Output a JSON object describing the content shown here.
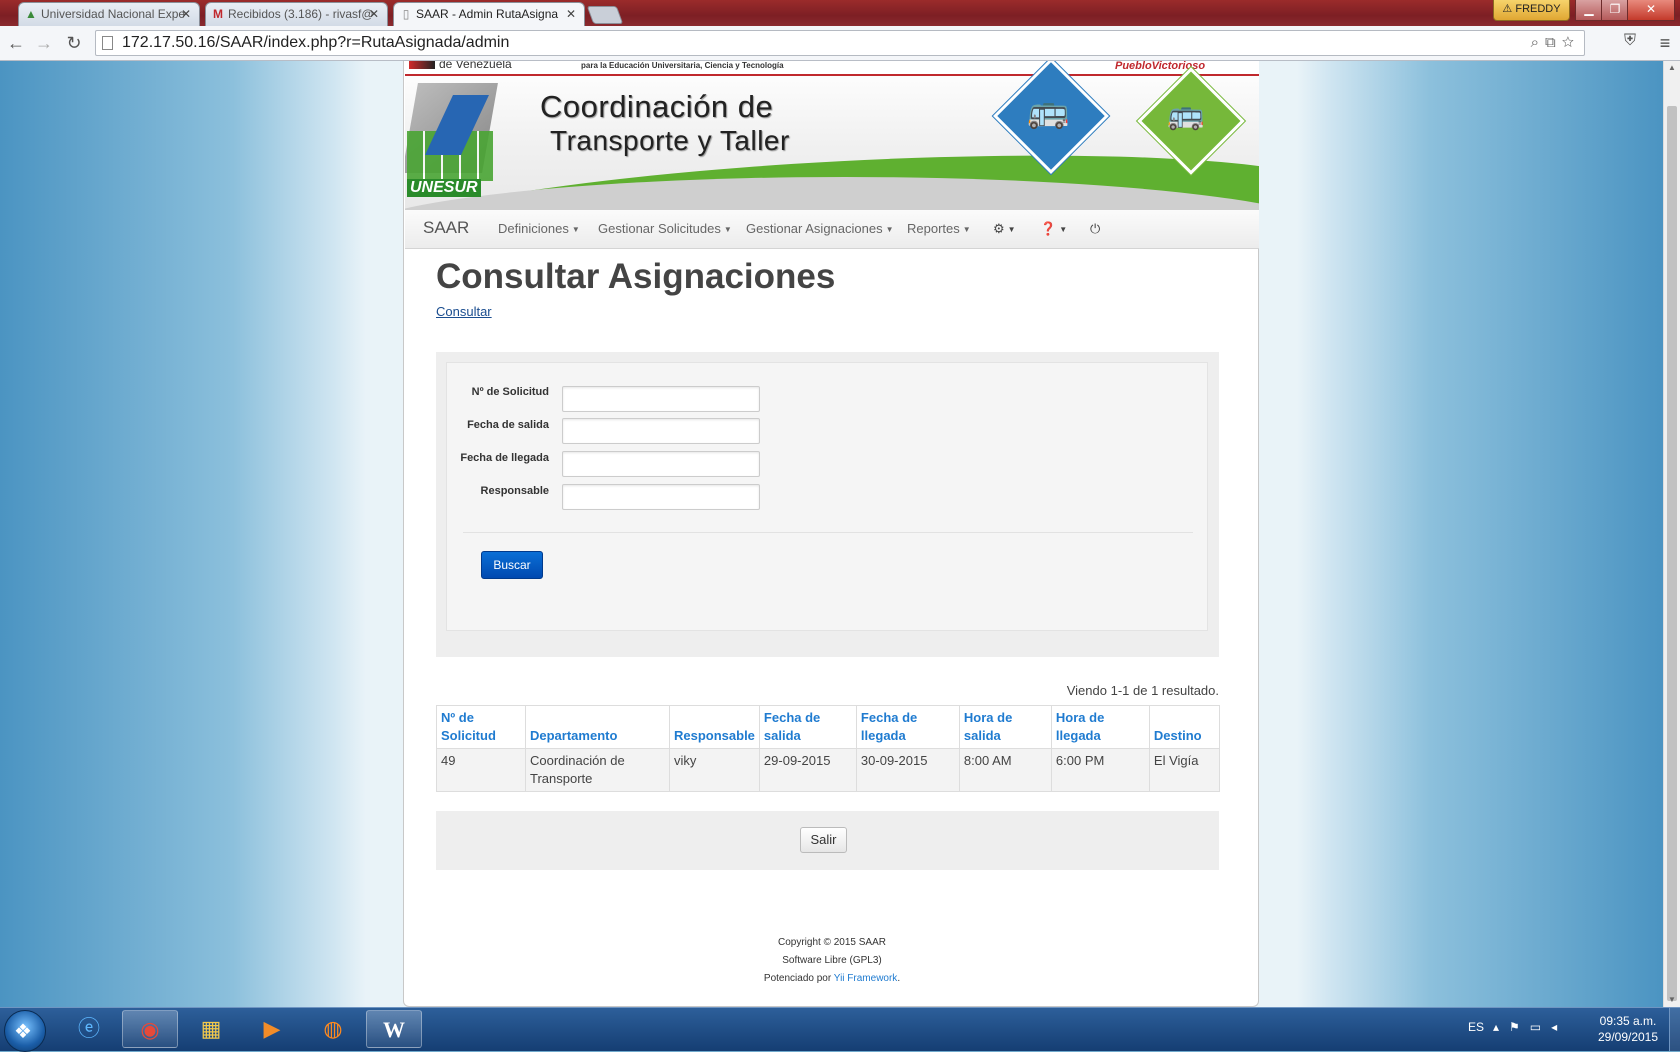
{
  "browser": {
    "tabs": [
      {
        "title": "Universidad Nacional Expe",
        "icon": "unesur-favicon"
      },
      {
        "title": "Recibidos (3.186) - rivasf@",
        "icon": "gmail-icon"
      },
      {
        "title": "SAAR - Admin RutaAsigna",
        "icon": "page-icon"
      }
    ],
    "user": "FREDDY",
    "address": "172.17.50.16/SAAR/index.php?r=RutaAsignada/admin"
  },
  "banner": {
    "gov_left": "de Venezuela",
    "gov_ministry": "para la Educación Universitaria, Ciencia y Tecnología",
    "gov_right": "PuebloVictorioso",
    "title_line1": "Coordinación de",
    "title_line2": "Transporte y Taller",
    "logo_text": "UNESUR"
  },
  "navbar": {
    "brand": "SAAR",
    "items": [
      "Definiciones",
      "Gestionar Solicitudes",
      "Gestionar Asignaciones",
      "Reportes"
    ]
  },
  "page": {
    "heading": "Consultar Asignaciones",
    "consult_link": "Consultar"
  },
  "search_form": {
    "fields": [
      {
        "label": "Nº de Solicitud",
        "value": ""
      },
      {
        "label": "Fecha de salida",
        "value": ""
      },
      {
        "label": "Fecha de llegada",
        "value": ""
      },
      {
        "label": "Responsable",
        "value": ""
      }
    ],
    "submit_label": "Buscar"
  },
  "results": {
    "summary": "Viendo 1-1 de 1 resultado.",
    "headers": [
      [
        "Nº de",
        "Solicitud"
      ],
      [
        "",
        "Departamento"
      ],
      [
        "",
        "Responsable"
      ],
      [
        "Fecha de",
        "salida"
      ],
      [
        "Fecha de",
        "llegada"
      ],
      [
        "Hora de",
        "salida"
      ],
      [
        "Hora de",
        "llegada"
      ],
      [
        "",
        "Destino"
      ]
    ],
    "rows": [
      [
        "49",
        "Coordinación de Transporte",
        "viky",
        "29-09-2015",
        "30-09-2015",
        "8:00 AM",
        "6:00 PM",
        "El Vigía"
      ]
    ]
  },
  "exit_label": "Salir",
  "footer": {
    "line1": "Copyright © 2015 SAAR",
    "line2": "Software Libre (GPL3)",
    "line3_prefix": "Potenciado por ",
    "line3_link": "Yii Framework",
    "line3_suffix": "."
  },
  "taskbar": {
    "language": "ES",
    "time": "09:35 a.m.",
    "date": "29/09/2015"
  }
}
